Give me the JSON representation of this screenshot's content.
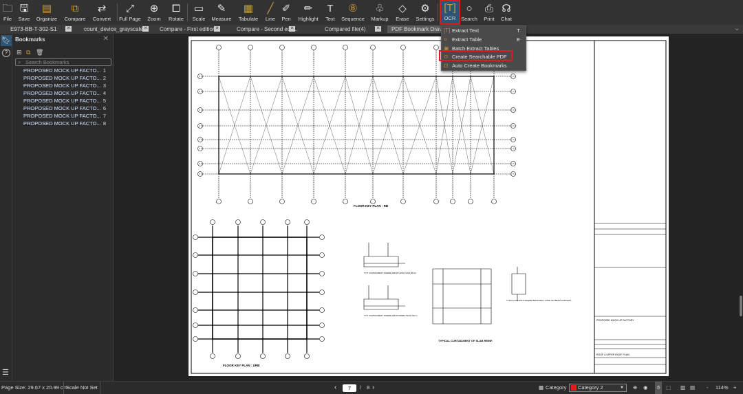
{
  "toolbar": {
    "items": [
      {
        "label": "File",
        "icon": "folder-icon"
      },
      {
        "label": "Save",
        "icon": "save-icon"
      },
      {
        "label": "Organize",
        "icon": "organize-icon"
      },
      {
        "label": "Compare",
        "icon": "compare-icon"
      },
      {
        "label": "Convert",
        "icon": "convert-icon"
      },
      {
        "label": "Full Page",
        "icon": "full-page-icon"
      },
      {
        "label": "Zoom",
        "icon": "zoom-icon"
      },
      {
        "label": "Rotate",
        "icon": "rotate-icon"
      },
      {
        "label": "Scale",
        "icon": "scale-icon"
      },
      {
        "label": "Measure",
        "icon": "measure-icon"
      },
      {
        "label": "Tabulate",
        "icon": "tabulate-icon"
      },
      {
        "label": "Line",
        "icon": "line-icon"
      },
      {
        "label": "Pen",
        "icon": "pen-icon"
      },
      {
        "label": "Highlight",
        "icon": "highlight-icon"
      },
      {
        "label": "Text",
        "icon": "text-icon"
      },
      {
        "label": "Sequence",
        "icon": "sequence-icon"
      },
      {
        "label": "Markup",
        "icon": "markup-icon"
      },
      {
        "label": "Erase",
        "icon": "erase-icon"
      },
      {
        "label": "Settings",
        "icon": "settings-icon"
      },
      {
        "label": "OCR",
        "icon": "ocr-icon"
      },
      {
        "label": "Search",
        "icon": "search-icon"
      },
      {
        "label": "Print",
        "icon": "print-icon"
      },
      {
        "label": "Chat",
        "icon": "chat-icon"
      }
    ]
  },
  "tabs": [
    "E973-BB-T-302-S1",
    "count_device_grayscale",
    "Compare - First edition...",
    "Compare - Second edit...",
    "Compared file(4)",
    "PDF Bookmark Drav"
  ],
  "ocr_menu": [
    {
      "label": "Extract Text",
      "shortcut": "T"
    },
    {
      "label": "Extract Table",
      "shortcut": "E"
    },
    {
      "label": "Batch Extract Tables",
      "shortcut": ""
    },
    {
      "label": "Create Searchable PDF",
      "shortcut": ""
    },
    {
      "label": "Auto Create Bookmarks",
      "shortcut": ""
    }
  ],
  "bookmarks": {
    "title": "Bookmarks",
    "search_placeholder": "Search Bookmarks",
    "items": [
      {
        "label": "PROPOSED MOCK UP FACTO...",
        "page": "1"
      },
      {
        "label": "PROPOSED MOCK UP FACTO...",
        "page": "2"
      },
      {
        "label": "PROPOSED MOCK UP FACTO...",
        "page": "3"
      },
      {
        "label": "PROPOSED MOCK UP FACTO...",
        "page": "4"
      },
      {
        "label": "PROPOSED MOCK UP FACTO...",
        "page": "5"
      },
      {
        "label": "PROPOSED MOCK UP FACTO...",
        "page": "6"
      },
      {
        "label": "PROPOSED MOCK UP FACTO...",
        "page": "7"
      },
      {
        "label": "PROPOSED MOCK UP FACTO...",
        "page": "8"
      }
    ]
  },
  "drawing": {
    "plan1": "FLOOR KEY PLAN : RB",
    "plan2": "FLOOR KEY PLAN : URB",
    "detail1": "TYP. CURTAILMENT WHERE DROP LESS THAN 50mm",
    "detail2": "TYP. CURTAILMENT WHERE DROP MORE THAN 50mm",
    "slab": "TYPICAL CURTAILMENT OF SLAB REINF.",
    "brick": "TYPICAL DETAILS WHERE BRICKWALL HAVE NO BEAM SUPPORT",
    "project": "PROPOSED MOCK UP FACTORY",
    "title": "ROOF & UPPER ROOF PLAN"
  },
  "status": {
    "page_size": "Page Size: 29.67 x 20.99 cm",
    "scale": "Scale Not Set",
    "current_page": "7",
    "separator": "/",
    "total_pages": "8",
    "category_label": "Category",
    "category_value": "Category 2",
    "zoom": "114%",
    "category_color": "#e31b1b"
  }
}
